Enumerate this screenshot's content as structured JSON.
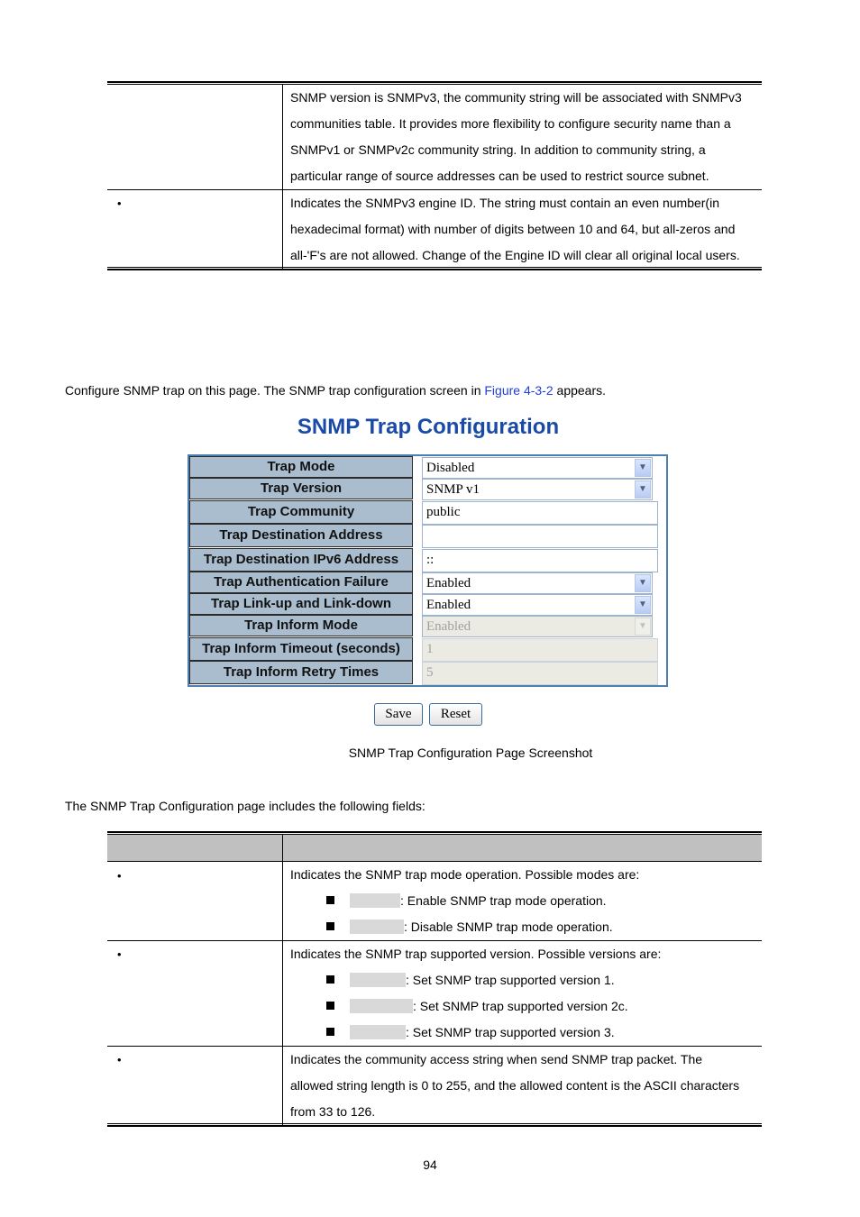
{
  "top_table": {
    "rows": [
      {
        "bullet": "",
        "lines": [
          "SNMP version is SNMPv3, the community string will be associated with SNMPv3",
          "communities table. It provides more flexibility to configure security name than a",
          "SNMPv1 or SNMPv2c community string. In addition to community string, a",
          "particular range of source addresses can be used to restrict source subnet."
        ]
      },
      {
        "bullet": "•",
        "lines": [
          "Indicates the SNMPv3 engine ID. The string must contain an even number(in",
          "hexadecimal format) with number of digits between 10 and 64, but all-zeros and",
          "all-'F's are not allowed. Change of the Engine ID will clear all original local users."
        ]
      }
    ]
  },
  "intro": {
    "before": "Configure SNMP trap on this page. The SNMP trap configuration screen in ",
    "link": "Figure 4-3-2",
    "after": " appears."
  },
  "config": {
    "title": "SNMP Trap Configuration",
    "fields": [
      {
        "label": "Trap Mode",
        "type": "select",
        "value": "Disabled",
        "disabled": false
      },
      {
        "label": "Trap Version",
        "type": "select",
        "value": "SNMP v1",
        "disabled": false
      },
      {
        "label": "Trap Community",
        "type": "text",
        "value": "public",
        "disabled": false
      },
      {
        "label": "Trap Destination Address",
        "type": "text",
        "value": "",
        "disabled": false
      },
      {
        "label": "Trap Destination IPv6 Address",
        "type": "text",
        "value": "::",
        "disabled": false
      },
      {
        "label": "Trap Authentication Failure",
        "type": "select",
        "value": "Enabled",
        "disabled": false
      },
      {
        "label": "Trap Link-up and Link-down",
        "type": "select",
        "value": "Enabled",
        "disabled": false
      },
      {
        "label": "Trap Inform Mode",
        "type": "select",
        "value": "Enabled",
        "disabled": true
      },
      {
        "label": "Trap Inform Timeout (seconds)",
        "type": "text",
        "value": "1",
        "disabled": true
      },
      {
        "label": "Trap Inform Retry Times",
        "type": "text",
        "value": "5",
        "disabled": true
      }
    ],
    "save_label": "Save",
    "reset_label": "Reset",
    "arrow_glyph": "▼"
  },
  "caption": "SNMP Trap Configuration Page Screenshot",
  "fields_intro": "The SNMP Trap Configuration page includes the following fields:",
  "fields_table": {
    "header": [
      "",
      ""
    ],
    "rows": [
      {
        "bullet": "•",
        "desc": "Indicates the SNMP trap mode operation. Possible modes are:",
        "subs": [
          ": Enable SNMP trap mode operation.",
          ": Disable SNMP trap mode operation."
        ]
      },
      {
        "bullet": "•",
        "desc": "Indicates the SNMP trap supported version. Possible versions are:",
        "subs": [
          ": Set SNMP trap supported version 1.",
          ": Set SNMP trap supported version 2c.",
          ": Set SNMP trap supported version 3."
        ]
      },
      {
        "bullet": "•",
        "lines": [
          "Indicates the community access string when send SNMP trap packet. The",
          "allowed string length is 0 to 255, and the allowed content is the ASCII characters",
          "from 33 to 126."
        ]
      }
    ]
  },
  "page_number": "94"
}
